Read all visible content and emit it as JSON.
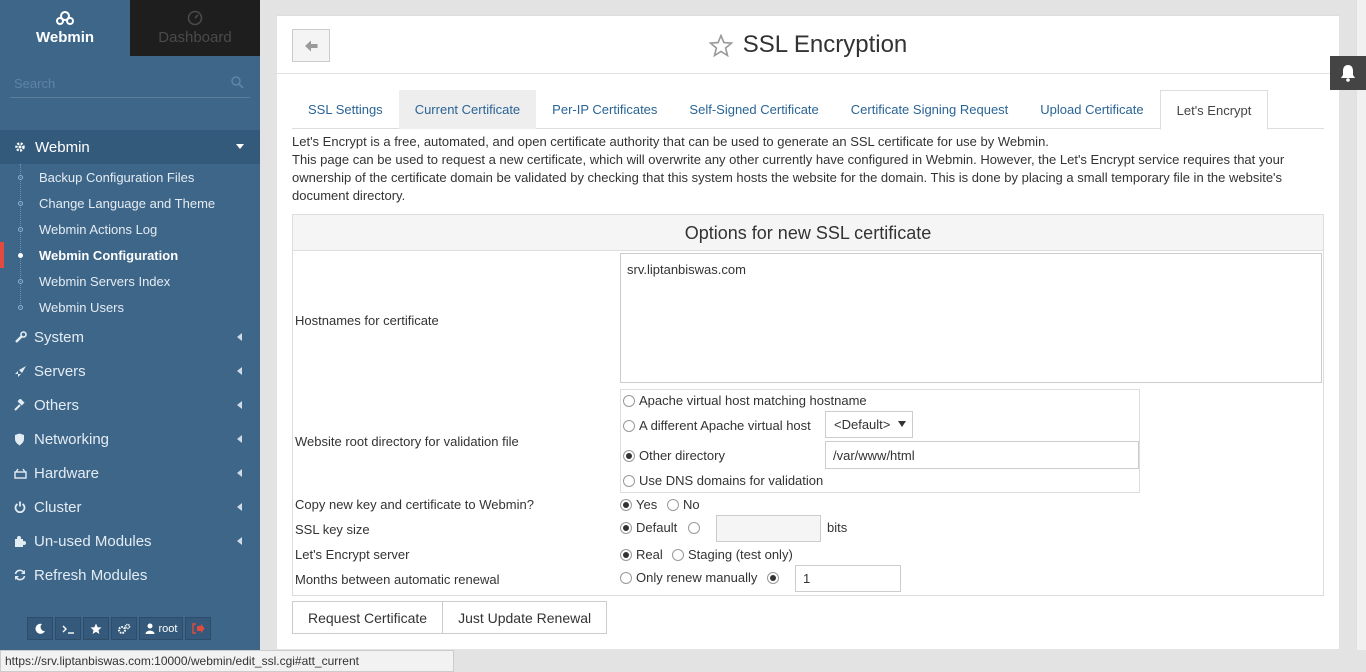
{
  "sidebar": {
    "brand_label": "Webmin",
    "dashboard_label": "Dashboard",
    "search_placeholder": "Search",
    "active_module": "Webmin",
    "sub_items": [
      "Backup Configuration Files",
      "Change Language and Theme",
      "Webmin Actions Log",
      "Webmin Configuration",
      "Webmin Servers Index",
      "Webmin Users"
    ],
    "current_item": "Webmin Configuration",
    "categories": [
      {
        "label": "System",
        "icon": "wrench-icon"
      },
      {
        "label": "Servers",
        "icon": "rocket-icon"
      },
      {
        "label": "Others",
        "icon": "gavel-icon"
      },
      {
        "label": "Networking",
        "icon": "shield-icon"
      },
      {
        "label": "Hardware",
        "icon": "hdd-icon"
      },
      {
        "label": "Cluster",
        "icon": "power-icon"
      },
      {
        "label": "Un-used Modules",
        "icon": "puzzle-icon"
      },
      {
        "label": "Refresh Modules",
        "icon": "refresh-icon"
      }
    ],
    "bottom_user": "root",
    "accent_color": "#e04b3f"
  },
  "page": {
    "title": "SSL Encryption",
    "tabs": [
      "SSL Settings",
      "Current Certificate",
      "Per-IP Certificates",
      "Self-Signed Certificate",
      "Certificate Signing Request",
      "Upload Certificate",
      "Let's Encrypt"
    ],
    "active_tab": "Let's Encrypt",
    "desc_line1": "Let's Encrypt is a free, automated, and open certificate authority that can be used to generate an SSL certificate for use by Webmin.",
    "desc_line2": "This page can be used to request a new certificate, which will overwrite any other currently have configured in Webmin. However, the Let's Encrypt service requires that your ownership of the certificate domain be validated by checking that this system hosts the website for the domain. This is done by placing a small temporary file in the website's document directory."
  },
  "form": {
    "section_title": "Options for new SSL certificate",
    "hostnames_label": "Hostnames for certificate",
    "hostnames_value": "srv.liptanbiswas.com",
    "webroot_label": "Website root directory for validation file",
    "webroot_opt1": "Apache virtual host matching hostname",
    "webroot_opt2": "A different Apache virtual host",
    "webroot_vhost_value": "<Default>",
    "webroot_opt3": "Other directory",
    "webroot_dir_value": "/var/www/html",
    "webroot_opt4": "Use DNS domains for validation",
    "copy_label": "Copy new key and certificate to Webmin?",
    "copy_yes": "Yes",
    "copy_no": "No",
    "keysize_label": "SSL key size",
    "keysize_default": "Default",
    "keysize_unit": "bits",
    "server_label": "Let's Encrypt server",
    "server_real": "Real",
    "server_staging": "Staging (test only)",
    "renew_label": "Months between automatic renewal",
    "renew_manual": "Only renew manually",
    "renew_value": "1"
  },
  "buttons": {
    "request": "Request Certificate",
    "update_renewal": "Just Update Renewal"
  },
  "status_url": "https://srv.liptanbiswas.com:10000/webmin/edit_ssl.cgi#att_current"
}
